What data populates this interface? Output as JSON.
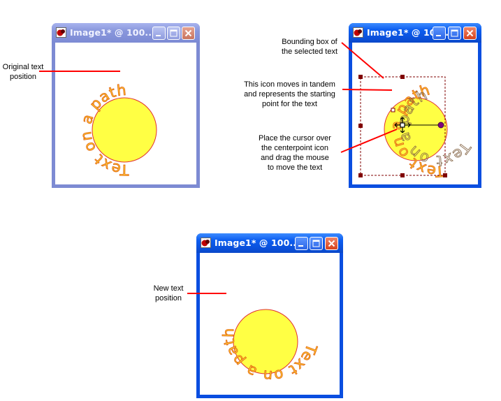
{
  "windows": [
    {
      "id": "win1",
      "title": "Image1* @ 100...",
      "state": "inactive"
    },
    {
      "id": "win2",
      "title": "Image1* @ 100...",
      "state": "active"
    },
    {
      "id": "win3",
      "title": "Image1* @ 100...",
      "state": "active"
    }
  ],
  "path_text": "Text on a path",
  "callouts": {
    "original_position": "Original text\nposition",
    "bounding_box": "Bounding box of\nthe selected text",
    "start_icon": "This icon moves in tandem\nand represents the starting\npoint for the text",
    "center_icon": "Place the cursor over\nthe centerpoint icon\nand drag the mouse\nto move the text",
    "new_position": "New text\nposition"
  },
  "colors": {
    "circle_fill": "#ffff44",
    "circle_stroke": "#e03030",
    "text_fill": "#ffcc33",
    "text_stroke": "#e06010",
    "leader_line": "#ff0000",
    "selection": "#800000"
  }
}
